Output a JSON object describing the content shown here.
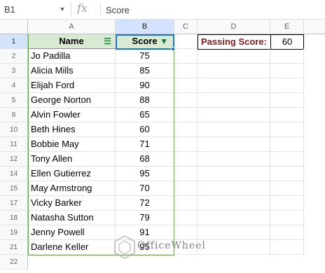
{
  "formula_bar": {
    "name_box": "B1",
    "fx_label": "fx",
    "formula": "Score"
  },
  "columns": [
    "A",
    "B",
    "C",
    "D",
    "E"
  ],
  "headers": {
    "name": "Name",
    "score": "Score"
  },
  "rows": [
    {
      "num": "2",
      "name": "Jo Padilla",
      "score": "75"
    },
    {
      "num": "3",
      "name": "Alicia Mills",
      "score": "85"
    },
    {
      "num": "4",
      "name": "Elijah Ford",
      "score": "90"
    },
    {
      "num": "5",
      "name": "George Norton",
      "score": "88"
    },
    {
      "num": "8",
      "name": "Alvin Fowler",
      "score": "65"
    },
    {
      "num": "10",
      "name": "Beth Hines",
      "score": "60"
    },
    {
      "num": "11",
      "name": "Bobbie May",
      "score": "71"
    },
    {
      "num": "12",
      "name": "Tony Allen",
      "score": "68"
    },
    {
      "num": "14",
      "name": "Ellen Gutierrez",
      "score": "95"
    },
    {
      "num": "15",
      "name": "May Armstrong",
      "score": "70"
    },
    {
      "num": "17",
      "name": "Vicky Barker",
      "score": "72"
    },
    {
      "num": "18",
      "name": "Natasha Sutton",
      "score": "79"
    },
    {
      "num": "19",
      "name": "Jenny Powell",
      "score": "91"
    },
    {
      "num": "21",
      "name": "Darlene Keller",
      "score": "95"
    }
  ],
  "header_row_num": "1",
  "empty_row_num": "22",
  "passing": {
    "label": "Passing Score:",
    "value": "60"
  },
  "watermark": "OfficeWheel",
  "colors": {
    "header_fill": "#d9ead3",
    "range_border": "#6aa84f",
    "selection": "#1a73e8",
    "pass_label_text": "#8b1a1a"
  }
}
